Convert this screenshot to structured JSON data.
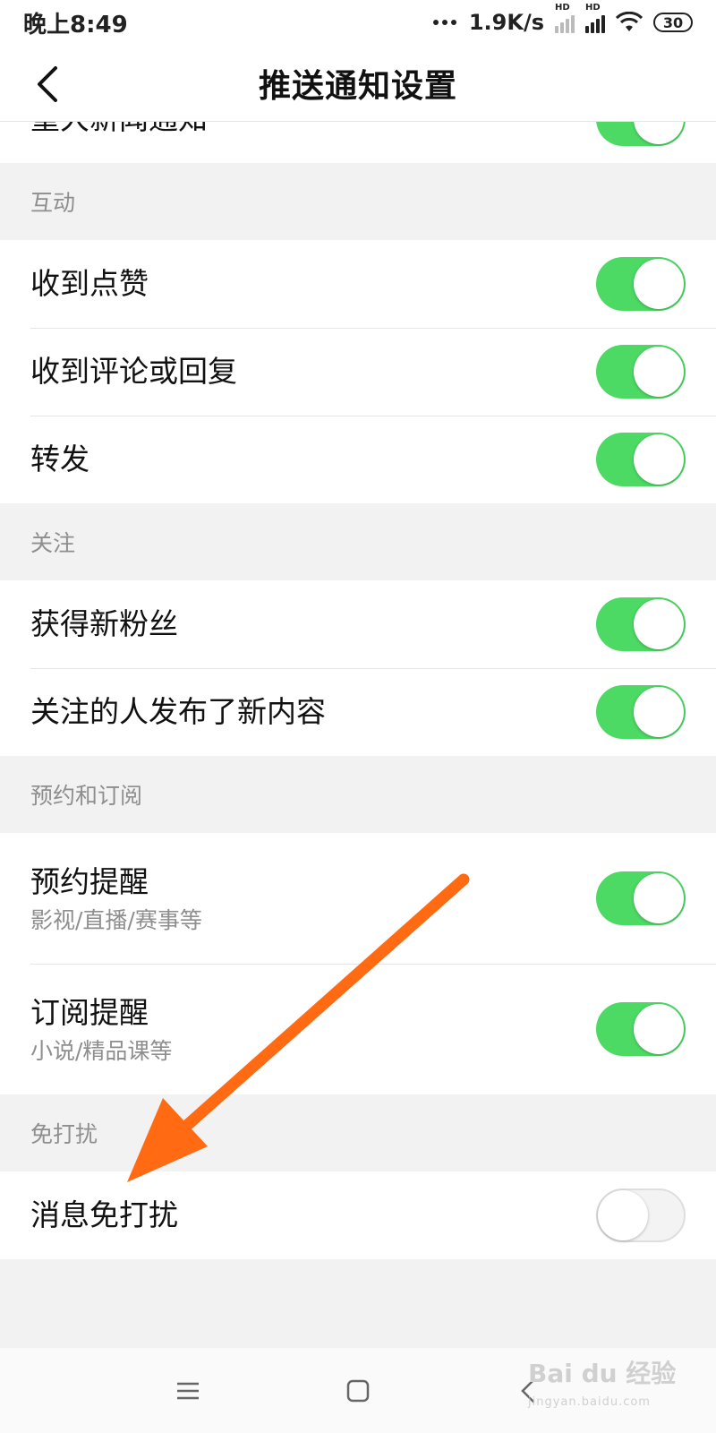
{
  "status_bar": {
    "time": "晚上8:49",
    "net_speed": "1.9K/s",
    "hd_label": "HD",
    "battery": "30"
  },
  "nav": {
    "title": "推送通知设置",
    "back_icon": "chevron-left-icon"
  },
  "sections": {
    "top": {
      "cut_item": {
        "label": "重大新闻通知",
        "on": true
      }
    },
    "interaction": {
      "header": "互动",
      "items": [
        {
          "label": "收到点赞",
          "on": true
        },
        {
          "label": "收到评论或回复",
          "on": true
        },
        {
          "label": "转发",
          "on": true
        }
      ]
    },
    "follow": {
      "header": "关注",
      "items": [
        {
          "label": "获得新粉丝",
          "on": true
        },
        {
          "label": "关注的人发布了新内容",
          "on": true
        }
      ]
    },
    "subscribe": {
      "header": "预约和订阅",
      "items": [
        {
          "label": "预约提醒",
          "sub": "影视/直播/赛事等",
          "on": true
        },
        {
          "label": "订阅提醒",
          "sub": "小说/精品课等",
          "on": true
        }
      ]
    },
    "dnd": {
      "header": "免打扰",
      "items": [
        {
          "label": "消息免打扰",
          "on": false
        }
      ]
    }
  },
  "bottom_nav": {
    "menu_icon": "menu-icon",
    "home_icon": "home-square-icon",
    "back_icon": "back-triangle-icon"
  },
  "watermark": {
    "text": "Bai du 经验",
    "sub": "jingyan.baidu.com"
  },
  "colors": {
    "switch_on": "#4cd964",
    "arrow": "#ff6a13"
  }
}
